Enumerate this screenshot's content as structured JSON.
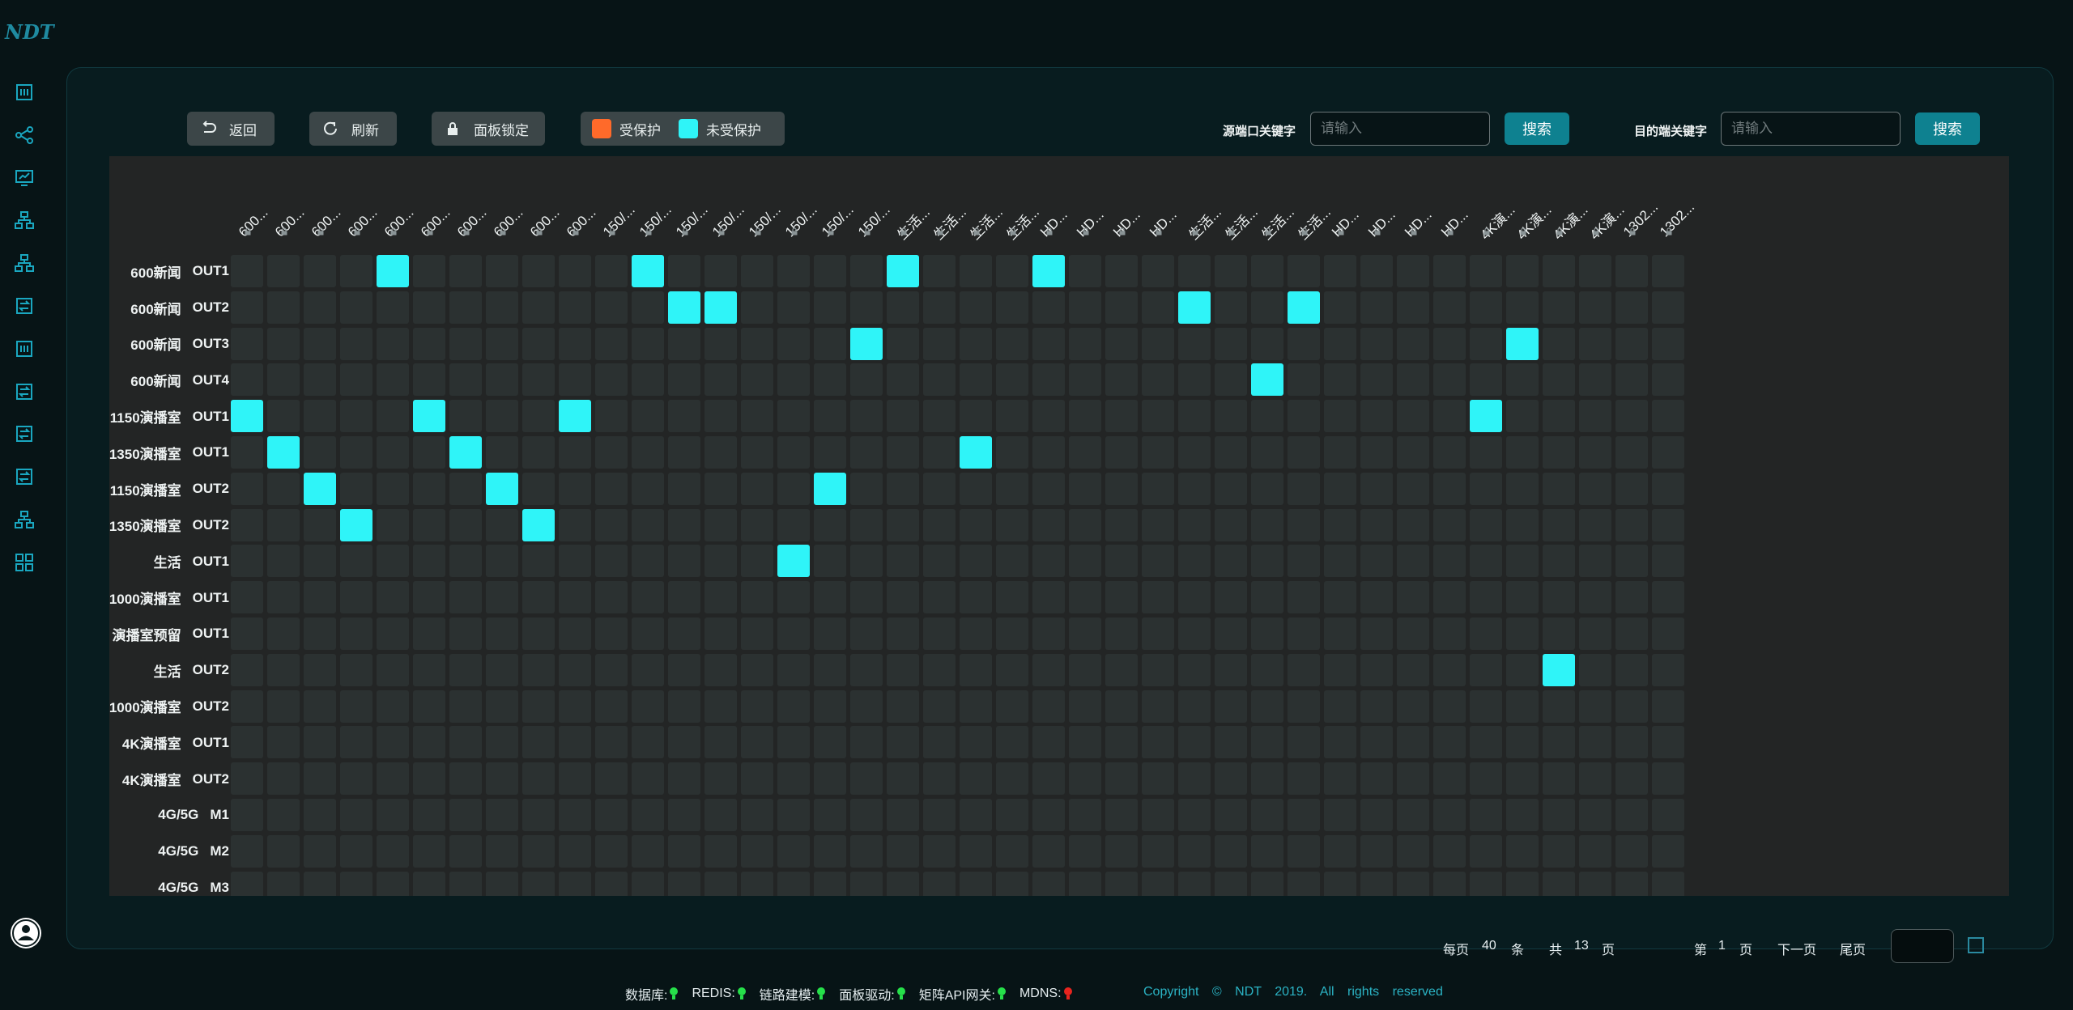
{
  "app": {
    "logo_text": "NDT"
  },
  "toolbar": {
    "back_label": "返回",
    "refresh_label": "刷新",
    "lock_label": "面板锁定",
    "legend_protected": "受保护",
    "legend_unprotected": "未受保护",
    "protected_color": "#ff6a2a",
    "unprotected_color": "#2ff4f8"
  },
  "search": {
    "source_label": "源端口关键字",
    "source_placeholder": "请输入",
    "source_button": "搜索",
    "dest_label": "目的端关键字",
    "dest_placeholder": "请输入",
    "dest_button": "搜索"
  },
  "matrix": {
    "columns": [
      "600...",
      "600...",
      "600...",
      "600...",
      "600...",
      "600...",
      "600...",
      "600...",
      "600...",
      "600...",
      "150/...",
      "150/...",
      "150/...",
      "150/...",
      "150/...",
      "150/...",
      "150/...",
      "150/...",
      "生活...",
      "生活...",
      "生活...",
      "生活...",
      "HD...",
      "HD...",
      "HD...",
      "HD...",
      "生活...",
      "生活...",
      "生活...",
      "生活...",
      "HD...",
      "HD...",
      "HD...",
      "HD...",
      "4K演...",
      "4K演...",
      "4K演...",
      "4K演...",
      "1302...",
      "1302..."
    ],
    "rows": [
      {
        "name": "600新闻",
        "port": "OUT1"
      },
      {
        "name": "600新闻",
        "port": "OUT2"
      },
      {
        "name": "600新闻",
        "port": "OUT3"
      },
      {
        "name": "600新闻",
        "port": "OUT4"
      },
      {
        "name": "1150演播室",
        "port": "OUT1"
      },
      {
        "name": "1350演播室",
        "port": "OUT1"
      },
      {
        "name": "1150演播室",
        "port": "OUT2"
      },
      {
        "name": "1350演播室",
        "port": "OUT2"
      },
      {
        "name": "生活",
        "port": "OUT1"
      },
      {
        "name": "1000演播室",
        "port": "OUT1"
      },
      {
        "name": "演播室预留",
        "port": "OUT1"
      },
      {
        "name": "生活",
        "port": "OUT2"
      },
      {
        "name": "1000演播室",
        "port": "OUT2"
      },
      {
        "name": "4K演播室",
        "port": "OUT1"
      },
      {
        "name": "4K演播室",
        "port": "OUT2"
      },
      {
        "name": "4G/5G",
        "port": "M1"
      },
      {
        "name": "4G/5G",
        "port": "M2"
      },
      {
        "name": "4G/5G",
        "port": "M3"
      }
    ],
    "connections": [
      [
        0,
        4
      ],
      [
        0,
        11
      ],
      [
        0,
        18
      ],
      [
        0,
        22
      ],
      [
        1,
        12
      ],
      [
        1,
        13
      ],
      [
        1,
        26
      ],
      [
        1,
        29
      ],
      [
        2,
        17
      ],
      [
        2,
        35
      ],
      [
        3,
        28
      ],
      [
        4,
        0
      ],
      [
        4,
        5
      ],
      [
        4,
        9
      ],
      [
        4,
        34
      ],
      [
        5,
        1
      ],
      [
        5,
        6
      ],
      [
        5,
        20
      ],
      [
        6,
        2
      ],
      [
        6,
        7
      ],
      [
        6,
        16
      ],
      [
        7,
        3
      ],
      [
        7,
        8
      ],
      [
        8,
        15
      ],
      [
        11,
        36
      ]
    ]
  },
  "pagination": {
    "per_page_label": "每页",
    "per_page": "40",
    "per_page_unit": "条",
    "total_label": "共",
    "total_pages": "13",
    "total_unit": "页",
    "page_prefix": "第",
    "current_page": "1",
    "page_suffix": "页",
    "next_label": "下一页",
    "last_label": "尾页"
  },
  "status": [
    {
      "label": "数据库:",
      "color": "#26e04a"
    },
    {
      "label": "REDIS:",
      "color": "#26e04a"
    },
    {
      "label": "链路建模:",
      "color": "#26e04a"
    },
    {
      "label": "面板驱动:",
      "color": "#26e04a"
    },
    {
      "label": "矩阵API网关:",
      "color": "#26e04a"
    },
    {
      "label": "MDNS:",
      "color": "#e8241e"
    }
  ],
  "copyright": "Copyright © NDT 2019. All rights reserved"
}
